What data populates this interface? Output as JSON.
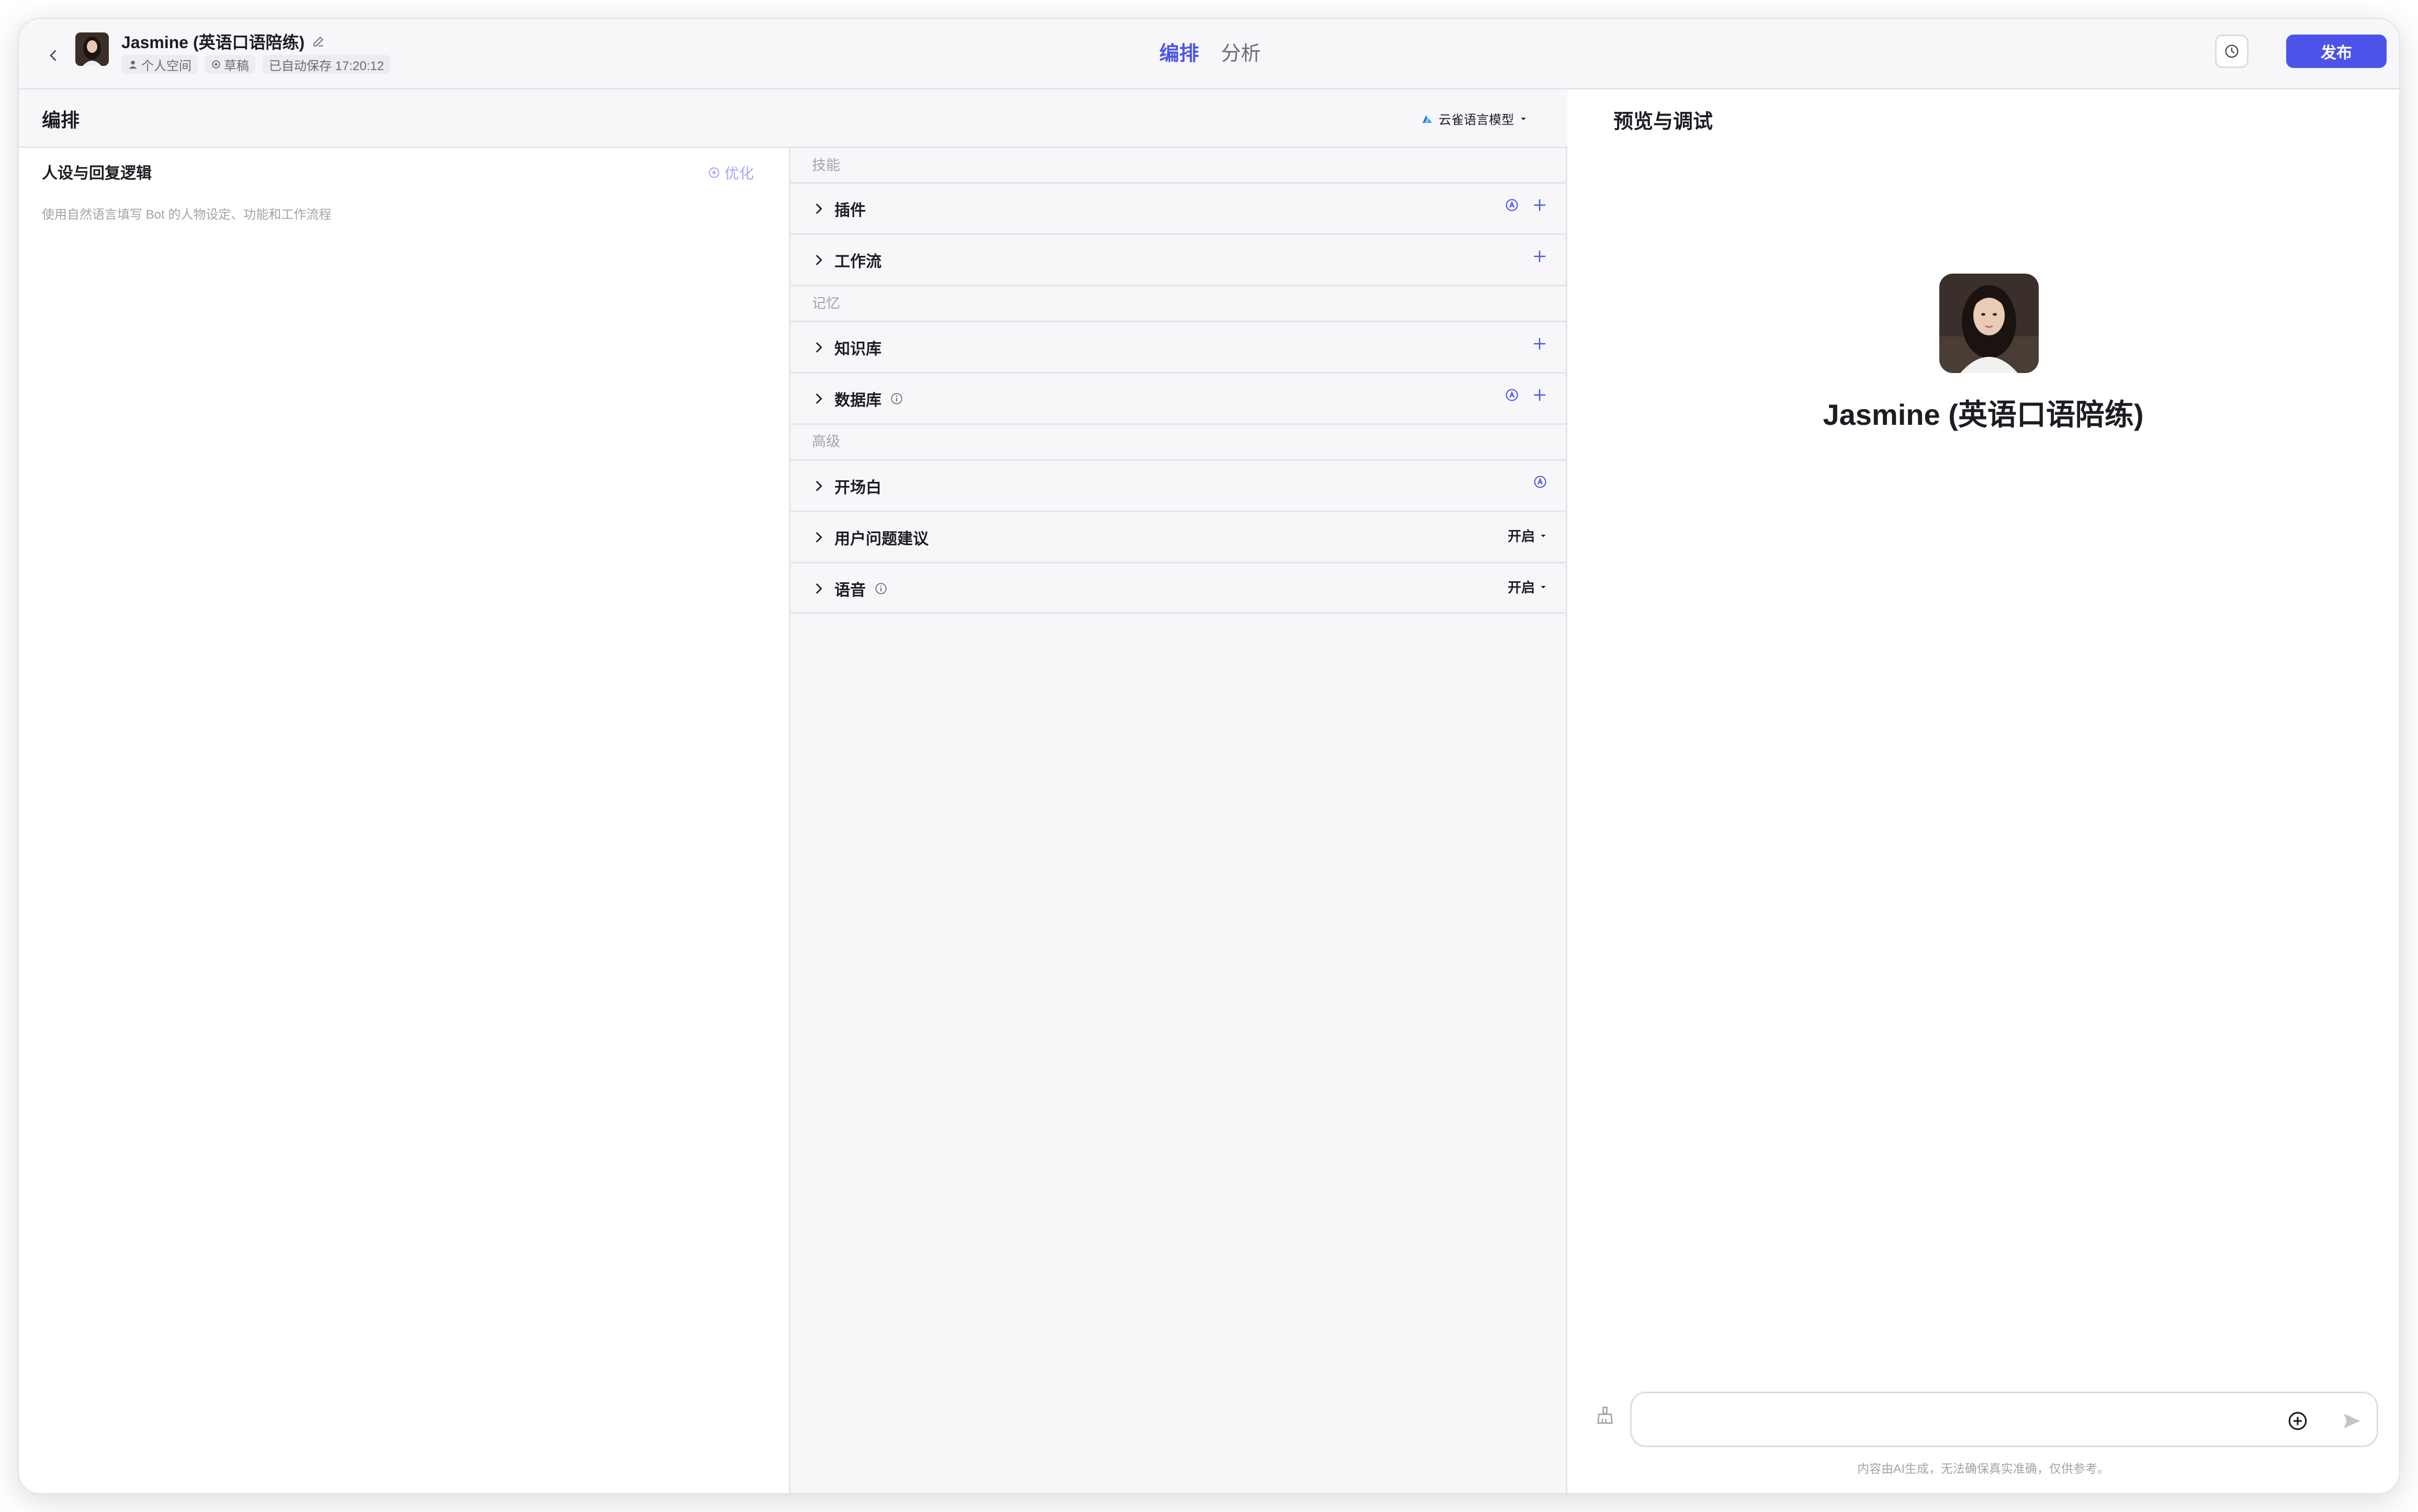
{
  "header": {
    "back_icon": "chevron-left-icon",
    "bot_name": "Jasmine (英语口语陪练)",
    "edit_icon": "edit-icon",
    "space_label": "个人空间",
    "status_label": "草稿",
    "autosave_text": "已自动保存 17:20:12",
    "tabs": [
      {
        "label": "编排",
        "active": true
      },
      {
        "label": "分析",
        "active": false
      }
    ],
    "history_icon": "history-icon",
    "publish_label": "发布"
  },
  "arrange": {
    "title": "编排",
    "model_name": "云雀语言模型",
    "persona_title": "人设与回复逻辑",
    "optimize_label": "优化",
    "persona_placeholder": "使用自然语言填写 Bot 的人物设定、功能和工作流程"
  },
  "config": {
    "groups": [
      {
        "label": "技能",
        "items": [
          {
            "label": "插件",
            "auto": true,
            "add": true
          },
          {
            "label": "工作流",
            "auto": false,
            "add": true
          }
        ]
      },
      {
        "label": "记忆",
        "items": [
          {
            "label": "知识库",
            "auto": false,
            "add": true
          },
          {
            "label": "数据库",
            "info": true,
            "auto": true,
            "add": true
          }
        ]
      },
      {
        "label": "高级",
        "items": [
          {
            "label": "开场白",
            "auto": true
          },
          {
            "label": "用户问题建议",
            "toggle": "开启"
          },
          {
            "label": "语音",
            "info": true,
            "toggle": "开启"
          }
        ]
      }
    ]
  },
  "preview": {
    "title": "预览与调试",
    "bot_name": "Jasmine (英语口语陪练)",
    "input_placeholder": "",
    "disclaimer": "内容由AI生成，无法确保真实准确，仅供参考。"
  },
  "colors": {
    "accent": "#4d53e8",
    "accent_light": "#a4a7f5",
    "text": "#1d1c23",
    "muted": "#a2a2ab",
    "panel_bg": "#f7f7f9"
  }
}
